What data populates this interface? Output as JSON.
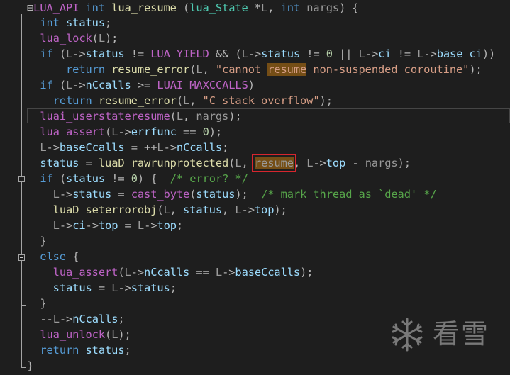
{
  "editor": {
    "lines": [
      [
        [
          "op",
          "⊟"
        ],
        [
          "mac",
          "LUA_API"
        ],
        [
          "t",
          " "
        ],
        [
          "kw",
          "int"
        ],
        [
          "t",
          " "
        ],
        [
          "fn",
          "lua_resume"
        ],
        [
          "t",
          " "
        ],
        [
          "op",
          "("
        ],
        [
          "ty",
          "lua_State"
        ],
        [
          "t",
          " "
        ],
        [
          "op",
          "*"
        ],
        [
          "pa",
          "L"
        ],
        [
          "op",
          ", "
        ],
        [
          "kw",
          "int"
        ],
        [
          "t",
          " "
        ],
        [
          "pa",
          "nargs"
        ],
        [
          "op",
          ") {"
        ]
      ],
      [
        [
          "t",
          "  "
        ],
        [
          "kw",
          "int"
        ],
        [
          "t",
          " "
        ],
        [
          "pr",
          "status"
        ],
        [
          "op",
          ";"
        ]
      ],
      [
        [
          "t",
          "  "
        ],
        [
          "mac",
          "lua_lock"
        ],
        [
          "op",
          "("
        ],
        [
          "pa",
          "L"
        ],
        [
          "op",
          ");"
        ]
      ],
      [
        [
          "t",
          "  "
        ],
        [
          "kw",
          "if"
        ],
        [
          "t",
          " "
        ],
        [
          "op",
          "("
        ],
        [
          "pa",
          "L"
        ],
        [
          "op",
          "->"
        ],
        [
          "pr",
          "status"
        ],
        [
          "t",
          " "
        ],
        [
          "op",
          "!="
        ],
        [
          "t",
          " "
        ],
        [
          "mac",
          "LUA_YIELD"
        ],
        [
          "t",
          " "
        ],
        [
          "op",
          "&&"
        ],
        [
          "t",
          " "
        ],
        [
          "op",
          "("
        ],
        [
          "pa",
          "L"
        ],
        [
          "op",
          "->"
        ],
        [
          "pr",
          "status"
        ],
        [
          "t",
          " "
        ],
        [
          "op",
          "!="
        ],
        [
          "t",
          " "
        ],
        [
          "num",
          "0"
        ],
        [
          "t",
          " "
        ],
        [
          "op",
          "||"
        ],
        [
          "t",
          " "
        ],
        [
          "pa",
          "L"
        ],
        [
          "op",
          "->"
        ],
        [
          "pr",
          "ci"
        ],
        [
          "t",
          " "
        ],
        [
          "op",
          "!="
        ],
        [
          "t",
          " "
        ],
        [
          "pa",
          "L"
        ],
        [
          "op",
          "->"
        ],
        [
          "pr",
          "base_ci"
        ],
        [
          "op",
          "))"
        ]
      ],
      [
        [
          "t",
          "      "
        ],
        [
          "kw",
          "return"
        ],
        [
          "t",
          " "
        ],
        [
          "fn",
          "resume_error"
        ],
        [
          "op",
          "("
        ],
        [
          "pa",
          "L"
        ],
        [
          "op",
          ", "
        ],
        [
          "str",
          "\"cannot "
        ],
        [
          "strhl",
          "resume"
        ],
        [
          "str",
          " non-suspended coroutine\""
        ],
        [
          "op",
          ");"
        ]
      ],
      [
        [
          "t",
          "  "
        ],
        [
          "kw",
          "if"
        ],
        [
          "t",
          " "
        ],
        [
          "op",
          "("
        ],
        [
          "pa",
          "L"
        ],
        [
          "op",
          "->"
        ],
        [
          "pr",
          "nCcalls"
        ],
        [
          "t",
          " "
        ],
        [
          "op",
          ">="
        ],
        [
          "t",
          " "
        ],
        [
          "mac",
          "LUAI_MAXCCALLS"
        ],
        [
          "op",
          ")"
        ]
      ],
      [
        [
          "t",
          "    "
        ],
        [
          "kw",
          "return"
        ],
        [
          "t",
          " "
        ],
        [
          "fn",
          "resume_error"
        ],
        [
          "op",
          "("
        ],
        [
          "pa",
          "L"
        ],
        [
          "op",
          ", "
        ],
        [
          "str",
          "\"C stack overflow\""
        ],
        [
          "op",
          ");"
        ]
      ],
      [
        [
          "t",
          "  "
        ],
        [
          "mac",
          "luai_userstateresume"
        ],
        [
          "op",
          "("
        ],
        [
          "pa",
          "L"
        ],
        [
          "op",
          ", "
        ],
        [
          "pa",
          "nargs"
        ],
        [
          "op",
          ");"
        ]
      ],
      [
        [
          "t",
          "  "
        ],
        [
          "mac",
          "lua_assert"
        ],
        [
          "op",
          "("
        ],
        [
          "pa",
          "L"
        ],
        [
          "op",
          "->"
        ],
        [
          "pr",
          "errfunc"
        ],
        [
          "t",
          " "
        ],
        [
          "op",
          "=="
        ],
        [
          "t",
          " "
        ],
        [
          "num",
          "0"
        ],
        [
          "op",
          ");"
        ]
      ],
      [
        [
          "t",
          "  "
        ],
        [
          "pa",
          "L"
        ],
        [
          "op",
          "->"
        ],
        [
          "pr",
          "baseCcalls"
        ],
        [
          "t",
          " "
        ],
        [
          "op",
          "="
        ],
        [
          "t",
          " "
        ],
        [
          "op",
          "++"
        ],
        [
          "pa",
          "L"
        ],
        [
          "op",
          "->"
        ],
        [
          "pr",
          "nCcalls"
        ],
        [
          "op",
          ";"
        ]
      ],
      [
        [
          "t",
          "  "
        ],
        [
          "pr",
          "status"
        ],
        [
          "t",
          " "
        ],
        [
          "op",
          "="
        ],
        [
          "t",
          " "
        ],
        [
          "fn",
          "luaD_rawrunprotected"
        ],
        [
          "op",
          "("
        ],
        [
          "pa",
          "L"
        ],
        [
          "op",
          ", "
        ],
        [
          "box",
          "resume"
        ],
        [
          "op",
          ", "
        ],
        [
          "pa",
          "L"
        ],
        [
          "op",
          "->"
        ],
        [
          "pr",
          "top"
        ],
        [
          "t",
          " "
        ],
        [
          "op",
          "-"
        ],
        [
          "t",
          " "
        ],
        [
          "pa",
          "nargs"
        ],
        [
          "op",
          ");"
        ]
      ],
      [
        [
          "t",
          "  "
        ],
        [
          "kw",
          "if"
        ],
        [
          "t",
          " "
        ],
        [
          "op",
          "("
        ],
        [
          "pr",
          "status"
        ],
        [
          "t",
          " "
        ],
        [
          "op",
          "!="
        ],
        [
          "t",
          " "
        ],
        [
          "num",
          "0"
        ],
        [
          "op",
          ")"
        ],
        [
          "t",
          " "
        ],
        [
          "op",
          "{"
        ],
        [
          "t",
          "  "
        ],
        [
          "cm",
          "/* error? */"
        ]
      ],
      [
        [
          "t",
          "    "
        ],
        [
          "pa",
          "L"
        ],
        [
          "op",
          "->"
        ],
        [
          "pr",
          "status"
        ],
        [
          "t",
          " "
        ],
        [
          "op",
          "="
        ],
        [
          "t",
          " "
        ],
        [
          "mac",
          "cast_byte"
        ],
        [
          "op",
          "("
        ],
        [
          "pr",
          "status"
        ],
        [
          "op",
          ");"
        ],
        [
          "t",
          "  "
        ],
        [
          "cm",
          "/* mark thread as `dead' */"
        ]
      ],
      [
        [
          "t",
          "    "
        ],
        [
          "fn",
          "luaD_seterrorobj"
        ],
        [
          "op",
          "("
        ],
        [
          "pa",
          "L"
        ],
        [
          "op",
          ", "
        ],
        [
          "pr",
          "status"
        ],
        [
          "op",
          ", "
        ],
        [
          "pa",
          "L"
        ],
        [
          "op",
          "->"
        ],
        [
          "pr",
          "top"
        ],
        [
          "op",
          ");"
        ]
      ],
      [
        [
          "t",
          "    "
        ],
        [
          "pa",
          "L"
        ],
        [
          "op",
          "->"
        ],
        [
          "pr",
          "ci"
        ],
        [
          "op",
          "->"
        ],
        [
          "pr",
          "top"
        ],
        [
          "t",
          " "
        ],
        [
          "op",
          "="
        ],
        [
          "t",
          " "
        ],
        [
          "pa",
          "L"
        ],
        [
          "op",
          "->"
        ],
        [
          "pr",
          "top"
        ],
        [
          "op",
          ";"
        ]
      ],
      [
        [
          "t",
          "  "
        ],
        [
          "op",
          "}"
        ]
      ],
      [
        [
          "t",
          "  "
        ],
        [
          "kw",
          "else"
        ],
        [
          "t",
          " "
        ],
        [
          "op",
          "{"
        ]
      ],
      [
        [
          "t",
          "    "
        ],
        [
          "mac",
          "lua_assert"
        ],
        [
          "op",
          "("
        ],
        [
          "pa",
          "L"
        ],
        [
          "op",
          "->"
        ],
        [
          "pr",
          "nCcalls"
        ],
        [
          "t",
          " "
        ],
        [
          "op",
          "=="
        ],
        [
          "t",
          " "
        ],
        [
          "pa",
          "L"
        ],
        [
          "op",
          "->"
        ],
        [
          "pr",
          "baseCcalls"
        ],
        [
          "op",
          ");"
        ]
      ],
      [
        [
          "t",
          "    "
        ],
        [
          "pr",
          "status"
        ],
        [
          "t",
          " "
        ],
        [
          "op",
          "="
        ],
        [
          "t",
          " "
        ],
        [
          "pa",
          "L"
        ],
        [
          "op",
          "->"
        ],
        [
          "pr",
          "status"
        ],
        [
          "op",
          ";"
        ]
      ],
      [
        [
          "t",
          "  "
        ],
        [
          "op",
          "}"
        ]
      ],
      [
        [
          "t",
          "  "
        ],
        [
          "op",
          "--"
        ],
        [
          "pa",
          "L"
        ],
        [
          "op",
          "->"
        ],
        [
          "pr",
          "nCcalls"
        ],
        [
          "op",
          ";"
        ]
      ],
      [
        [
          "t",
          "  "
        ],
        [
          "mac",
          "lua_unlock"
        ],
        [
          "op",
          "("
        ],
        [
          "pa",
          "L"
        ],
        [
          "op",
          ");"
        ]
      ],
      [
        [
          "t",
          "  "
        ],
        [
          "kw",
          "return"
        ],
        [
          "t",
          " "
        ],
        [
          "pr",
          "status"
        ],
        [
          "op",
          ";"
        ]
      ],
      [
        [
          "op",
          "}"
        ]
      ]
    ]
  },
  "watermark": {
    "text": "看雪",
    "icon": "snowflake-icon"
  },
  "colors": {
    "background": "#1e1e1e",
    "highlight": "#754e16",
    "box": "#d7262e"
  }
}
